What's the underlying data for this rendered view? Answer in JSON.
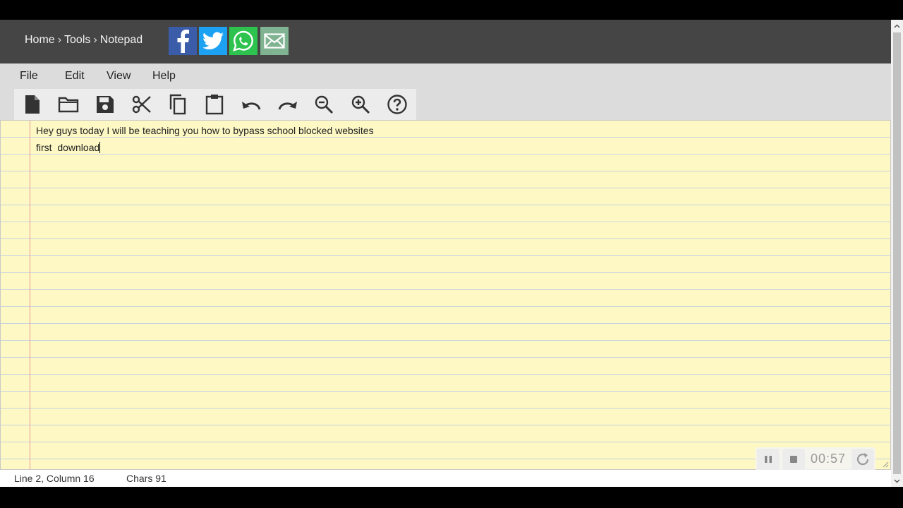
{
  "breadcrumb": {
    "home": "Home",
    "tools": "Tools",
    "current": "Notepad",
    "separator": "›"
  },
  "share": {
    "facebook_icon": "facebook-icon",
    "twitter_icon": "twitter-icon",
    "whatsapp_icon": "whatsapp-icon",
    "email_icon": "mail-icon"
  },
  "menu": {
    "file": "File",
    "edit": "Edit",
    "view": "View",
    "help": "Help"
  },
  "toolbar": [
    "new-file",
    "open-folder",
    "save",
    "cut",
    "copy",
    "paste",
    "undo",
    "redo",
    "zoom-out",
    "zoom-in",
    "help"
  ],
  "editor": {
    "lines": [
      "Hey guys today I will be teaching you how to bypass school blocked websites",
      "first  download"
    ]
  },
  "recorder": {
    "time": "00:57"
  },
  "status": {
    "position": "Line 2, Column 16",
    "chars": "Chars 91"
  },
  "colors": {
    "header": "#454545",
    "paper": "#fdf8c4",
    "margin_line": "#e79a9a",
    "facebook": "#3b5ca8",
    "twitter": "#1da1f2",
    "whatsapp": "#2ec34f",
    "email": "#7fb391"
  }
}
